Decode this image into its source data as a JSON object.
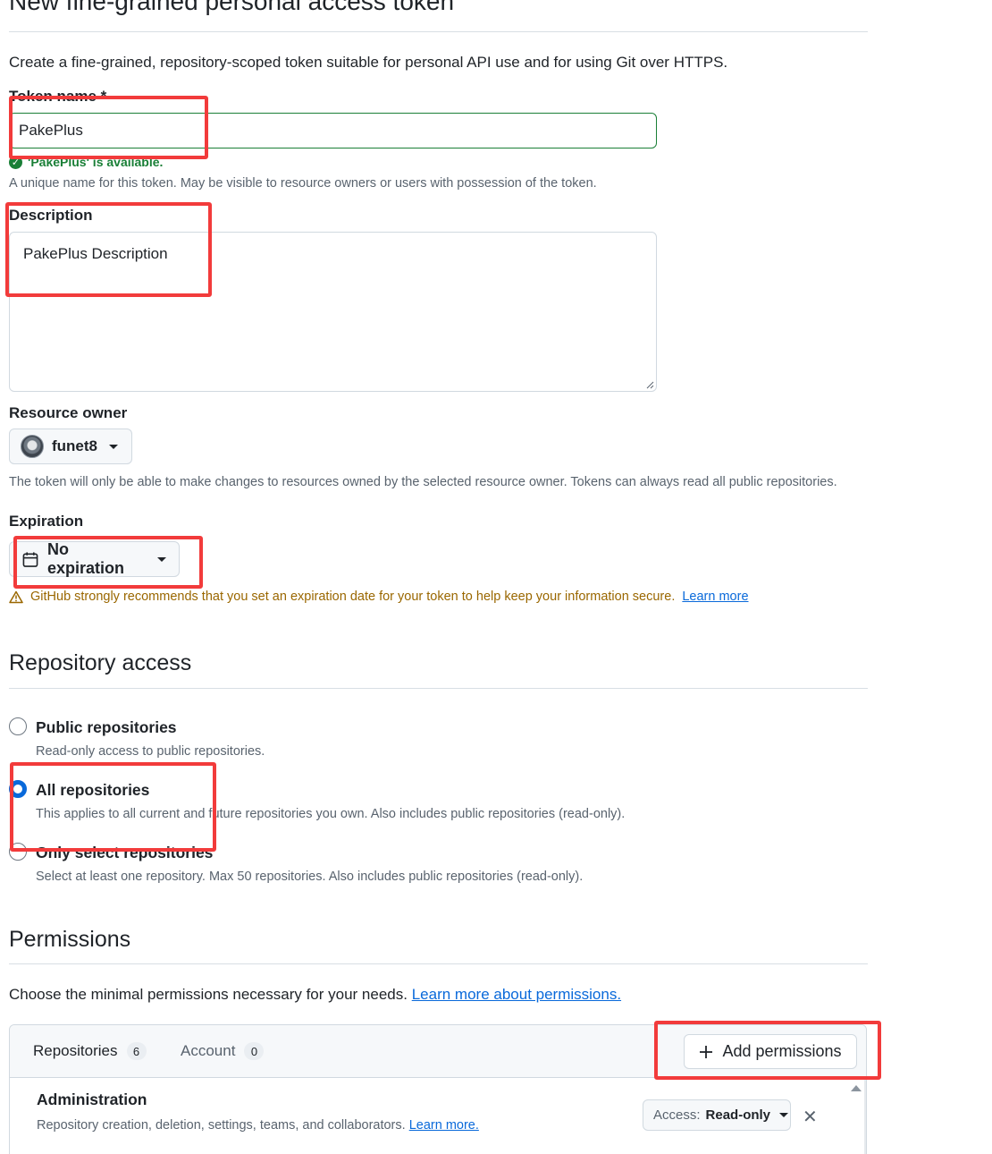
{
  "page": {
    "title": "New fine-grained personal access token",
    "intro": "Create a fine-grained, repository-scoped token suitable for personal API use and for using Git over HTTPS."
  },
  "token_name": {
    "label": "Token name *",
    "value": "PakePlus",
    "availability": "'PakePlus' is available.",
    "hint": "A unique name for this token. May be visible to resource owners or users with possession of the token."
  },
  "description": {
    "label": "Description",
    "value": "PakePlus Description"
  },
  "resource_owner": {
    "label": "Resource owner",
    "selected": "funet8",
    "hint": "The token will only be able to make changes to resources owned by the selected resource owner. Tokens can always read all public repositories."
  },
  "expiration": {
    "label": "Expiration",
    "selected": "No expiration",
    "warning": "GitHub strongly recommends that you set an expiration date for your token to help keep your information secure.",
    "learn_more": "Learn more"
  },
  "repository_access": {
    "heading": "Repository access",
    "options": [
      {
        "title": "Public repositories",
        "desc": "Read-only access to public repositories.",
        "checked": false
      },
      {
        "title": "All repositories",
        "desc": "This applies to all current and future repositories you own. Also includes public repositories (read-only).",
        "checked": true
      },
      {
        "title": "Only select repositories",
        "desc": "Select at least one repository. Max 50 repositories. Also includes public repositories (read-only).",
        "checked": false
      }
    ]
  },
  "permissions": {
    "heading": "Permissions",
    "intro": "Choose the minimal permissions necessary for your needs.",
    "intro_link": "Learn more about permissions.",
    "tabs": [
      {
        "label": "Repositories",
        "count": "6"
      },
      {
        "label": "Account",
        "count": "0"
      }
    ],
    "add_button": "Add permissions",
    "items": [
      {
        "title": "Administration",
        "desc": "Repository creation, deletion, settings, teams, and collaborators.",
        "link": "Learn more.",
        "access_key": "Access:",
        "access_value": "Read-only"
      }
    ]
  },
  "colors": {
    "accent": "#0969da",
    "success": "#1a7f37",
    "warning": "#9a6700",
    "annotation": "#f23b3b"
  }
}
